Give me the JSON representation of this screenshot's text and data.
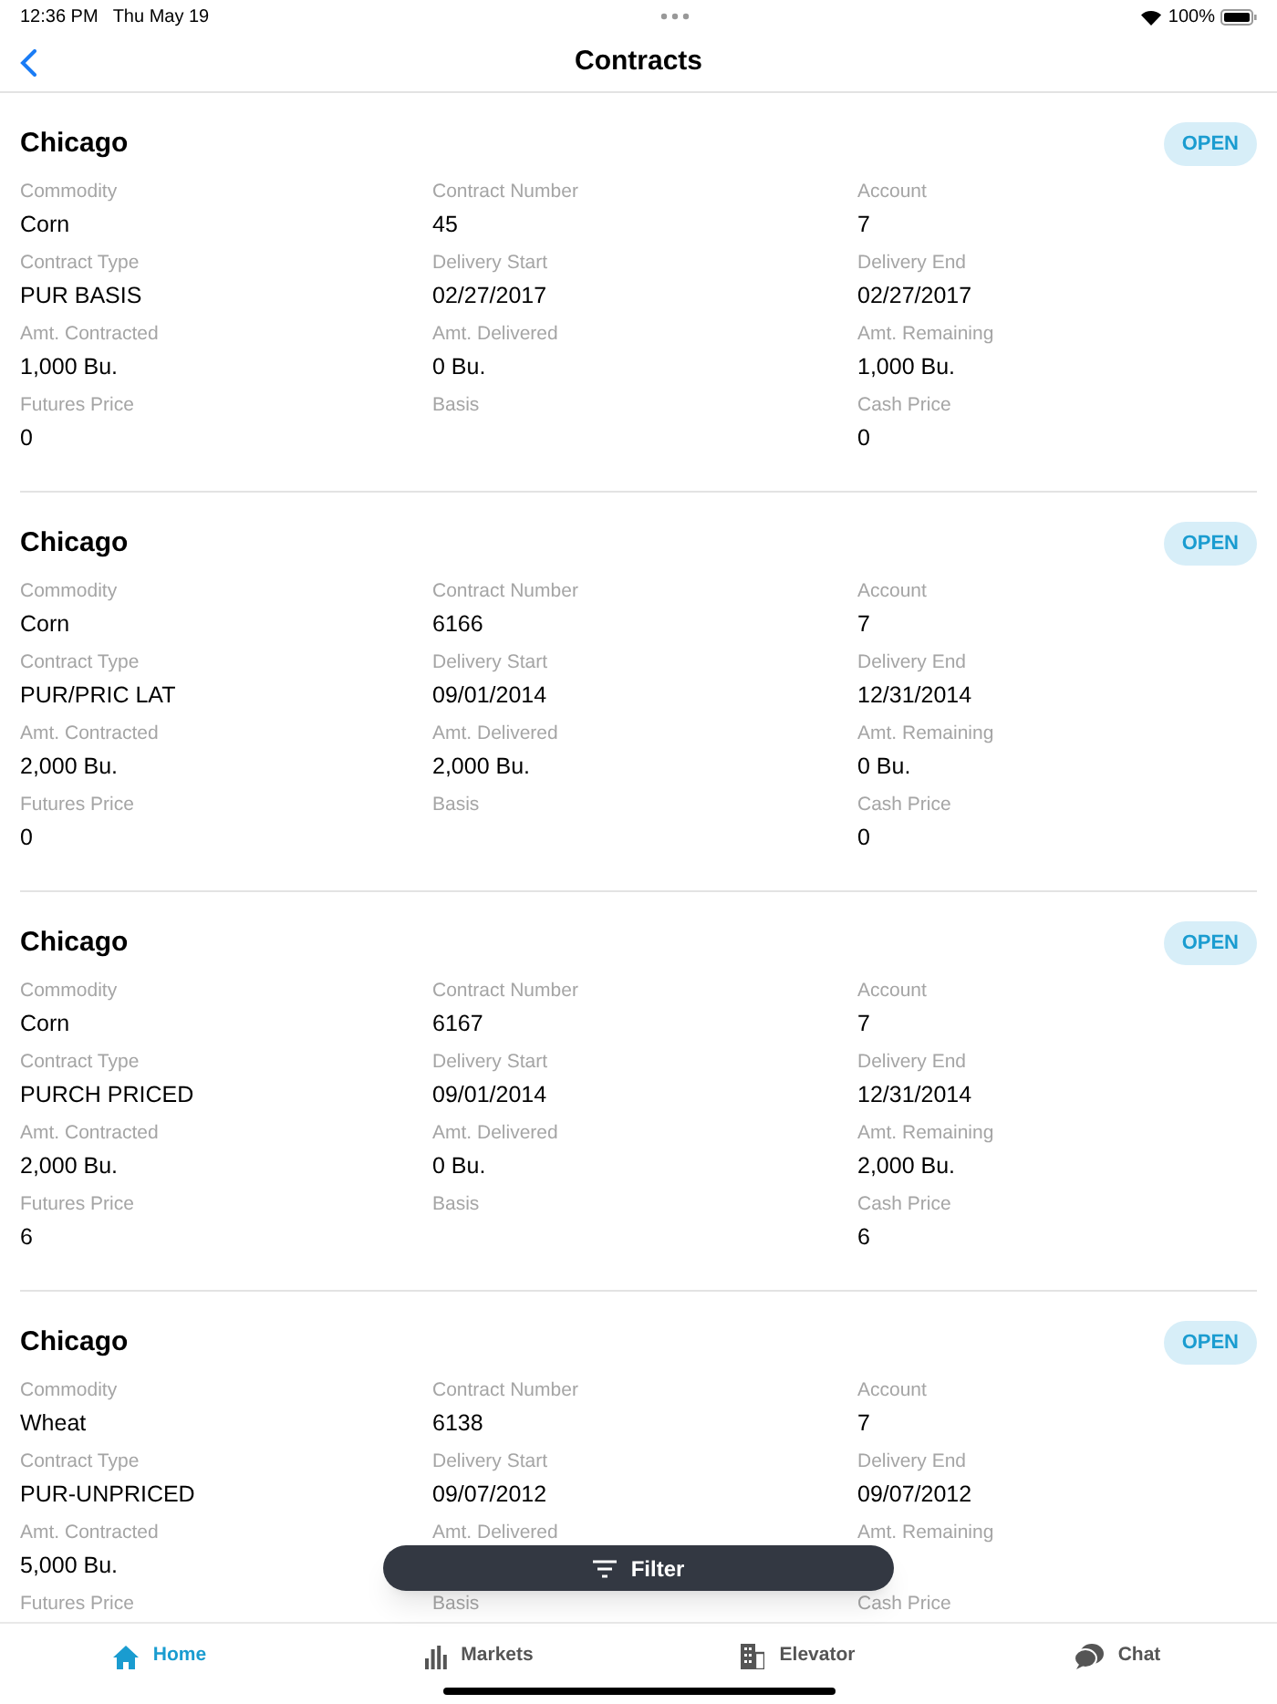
{
  "status_bar": {
    "time": "12:36 PM",
    "date": "Thu May 19",
    "battery": "100%"
  },
  "nav": {
    "title": "Contracts"
  },
  "contracts": [
    {
      "location": "Chicago",
      "status": "OPEN",
      "fields": [
        {
          "label": "Commodity",
          "value": "Corn"
        },
        {
          "label": "Contract Number",
          "value": "45"
        },
        {
          "label": "Account",
          "value": "7"
        },
        {
          "label": "Contract Type",
          "value": "PUR BASIS"
        },
        {
          "label": "Delivery Start",
          "value": "02/27/2017"
        },
        {
          "label": "Delivery End",
          "value": "02/27/2017"
        },
        {
          "label": "Amt. Contracted",
          "value": "1,000 Bu."
        },
        {
          "label": "Amt. Delivered",
          "value": "0 Bu."
        },
        {
          "label": "Amt. Remaining",
          "value": "1,000 Bu."
        },
        {
          "label": "Futures Price",
          "value": "0"
        },
        {
          "label": "Basis"
        },
        {
          "label": "Cash Price",
          "value": "0"
        }
      ]
    },
    {
      "location": "Chicago",
      "status": "OPEN",
      "fields": [
        {
          "label": "Commodity",
          "value": "Corn"
        },
        {
          "label": "Contract Number",
          "value": "6166"
        },
        {
          "label": "Account",
          "value": "7"
        },
        {
          "label": "Contract Type",
          "value": "PUR/PRIC LAT"
        },
        {
          "label": "Delivery Start",
          "value": "09/01/2014"
        },
        {
          "label": "Delivery End",
          "value": "12/31/2014"
        },
        {
          "label": "Amt. Contracted",
          "value": "2,000 Bu."
        },
        {
          "label": "Amt. Delivered",
          "value": "2,000 Bu."
        },
        {
          "label": "Amt. Remaining",
          "value": "0 Bu."
        },
        {
          "label": "Futures Price",
          "value": "0"
        },
        {
          "label": "Basis"
        },
        {
          "label": "Cash Price",
          "value": "0"
        }
      ]
    },
    {
      "location": "Chicago",
      "status": "OPEN",
      "fields": [
        {
          "label": "Commodity",
          "value": "Corn"
        },
        {
          "label": "Contract Number",
          "value": "6167"
        },
        {
          "label": "Account",
          "value": "7"
        },
        {
          "label": "Contract Type",
          "value": "PURCH PRICED"
        },
        {
          "label": "Delivery Start",
          "value": "09/01/2014"
        },
        {
          "label": "Delivery End",
          "value": "12/31/2014"
        },
        {
          "label": "Amt. Contracted",
          "value": "2,000 Bu."
        },
        {
          "label": "Amt. Delivered",
          "value": "0 Bu."
        },
        {
          "label": "Amt. Remaining",
          "value": "2,000 Bu."
        },
        {
          "label": "Futures Price",
          "value": "6"
        },
        {
          "label": "Basis"
        },
        {
          "label": "Cash Price",
          "value": "6"
        }
      ]
    },
    {
      "location": "Chicago",
      "status": "OPEN",
      "fields": [
        {
          "label": "Commodity",
          "value": "Wheat"
        },
        {
          "label": "Contract Number",
          "value": "6138"
        },
        {
          "label": "Account",
          "value": "7"
        },
        {
          "label": "Contract Type",
          "value": "PUR-UNPRICED"
        },
        {
          "label": "Delivery Start",
          "value": "09/07/2012"
        },
        {
          "label": "Delivery End",
          "value": "09/07/2012"
        },
        {
          "label": "Amt. Contracted",
          "value": "5,000 Bu."
        },
        {
          "label": "Amt. Delivered"
        },
        {
          "label": "Amt. Remaining"
        },
        {
          "label": "Futures Price"
        },
        {
          "label": "Basis"
        },
        {
          "label": "Cash Price"
        }
      ]
    }
  ],
  "filter_button": {
    "label": "Filter"
  },
  "tabs": [
    {
      "label": "Home",
      "selected": true
    },
    {
      "label": "Markets",
      "selected": false
    },
    {
      "label": "Elevator",
      "selected": false
    },
    {
      "label": "Chat",
      "selected": false
    }
  ]
}
